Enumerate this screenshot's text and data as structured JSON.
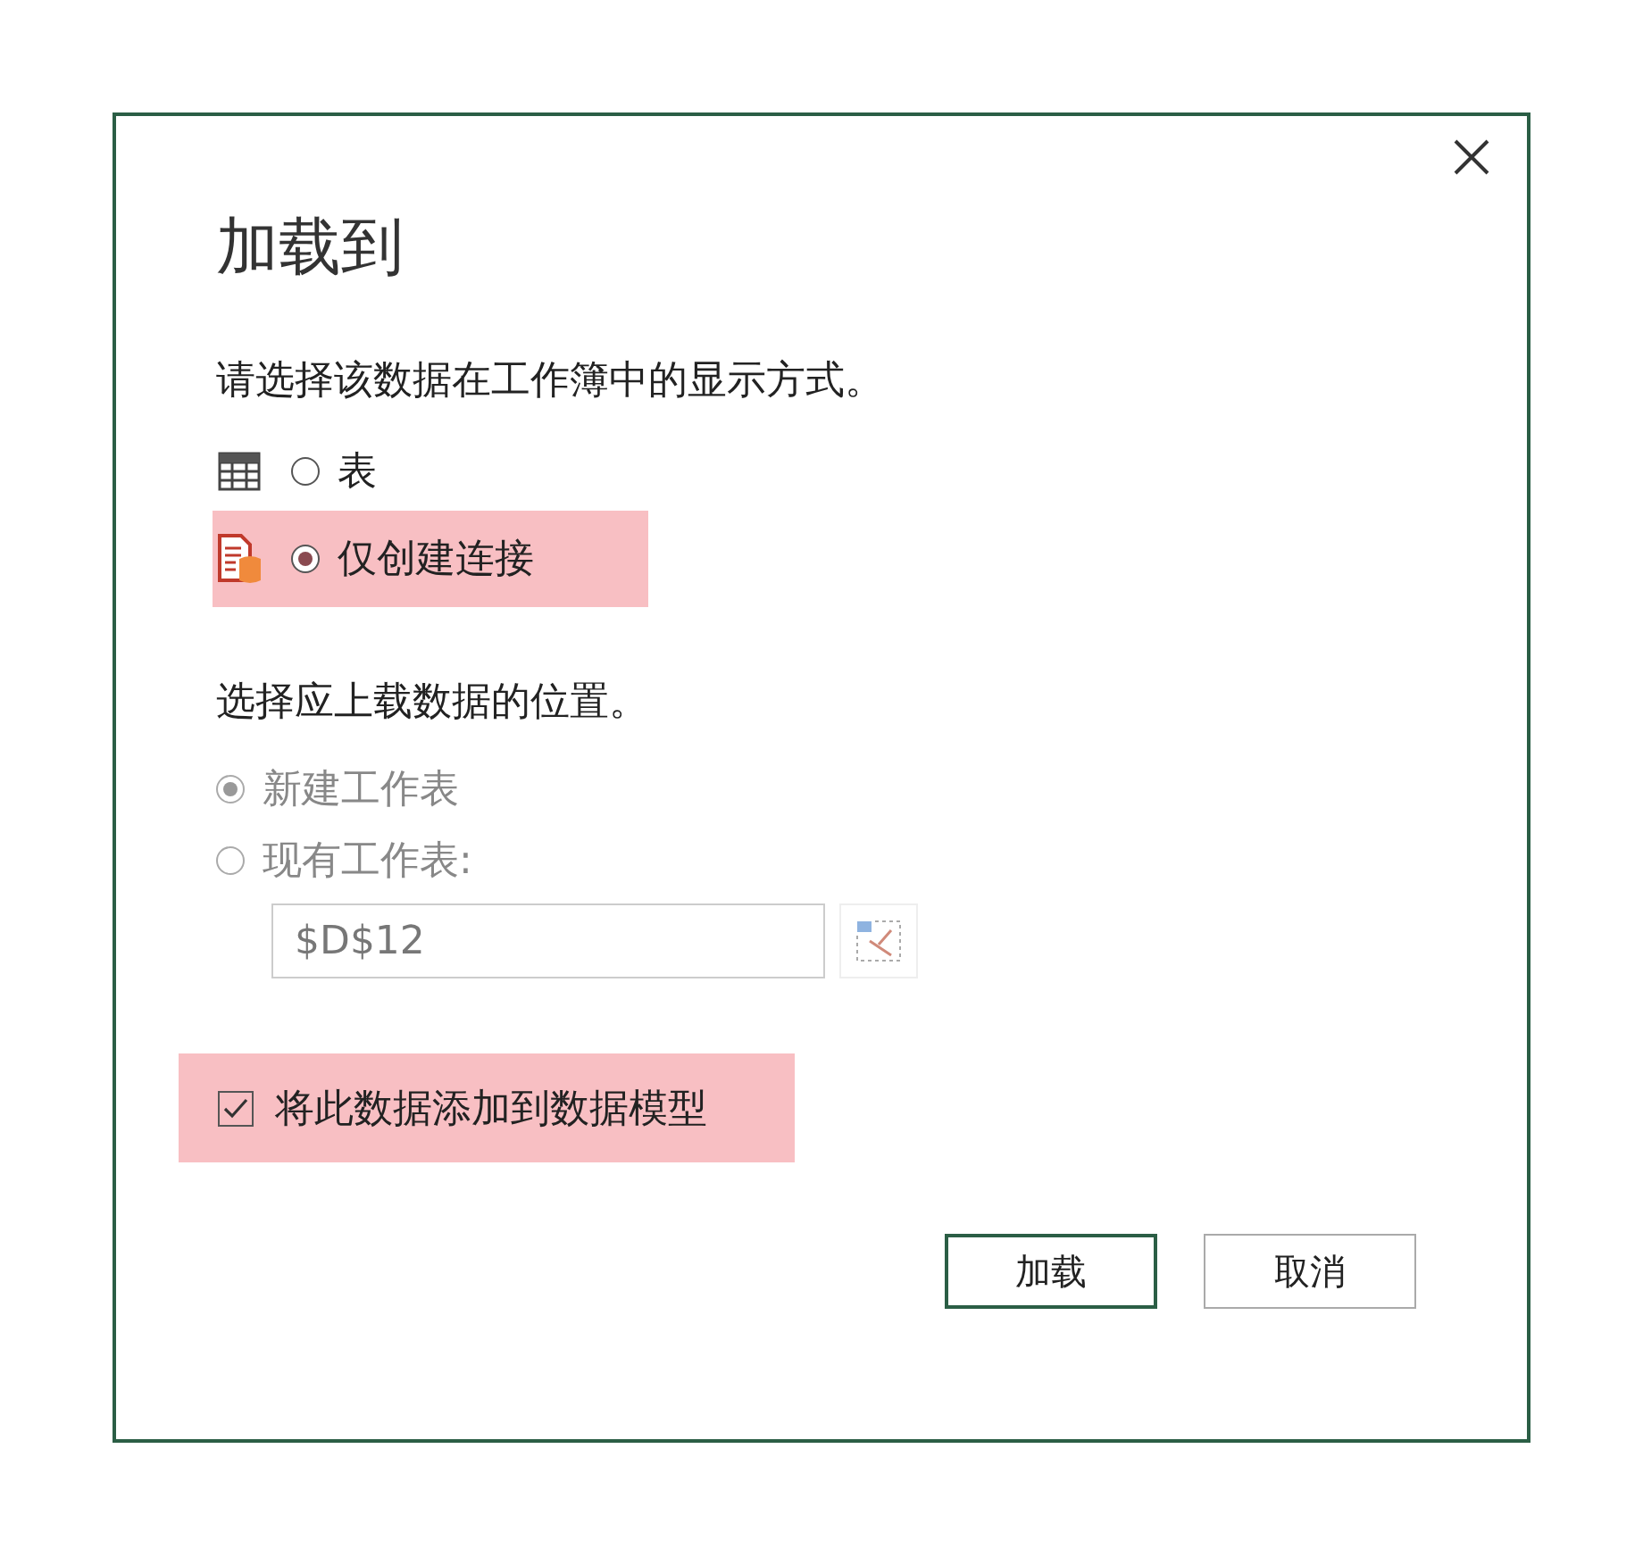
{
  "dialog": {
    "title": "加载到",
    "display_prompt": "请选择该数据在工作簿中的显示方式。",
    "display_options": [
      {
        "kind": "table",
        "label": "表",
        "selected": false,
        "highlighted": false
      },
      {
        "kind": "connection",
        "label": "仅创建连接",
        "selected": true,
        "highlighted": true
      }
    ],
    "location_prompt": "选择应上载数据的位置。",
    "location_options": [
      {
        "label": "新建工作表",
        "selected": true,
        "disabled": true
      },
      {
        "label": "现有工作表:",
        "selected": false,
        "disabled": true
      }
    ],
    "location_field": {
      "value": "$D$12",
      "disabled": true
    },
    "data_model": {
      "label": "将此数据添加到数据模型",
      "checked": true,
      "highlighted": true
    },
    "buttons": [
      {
        "label": "加载",
        "default": true
      },
      {
        "label": "取消",
        "default": false
      }
    ]
  }
}
